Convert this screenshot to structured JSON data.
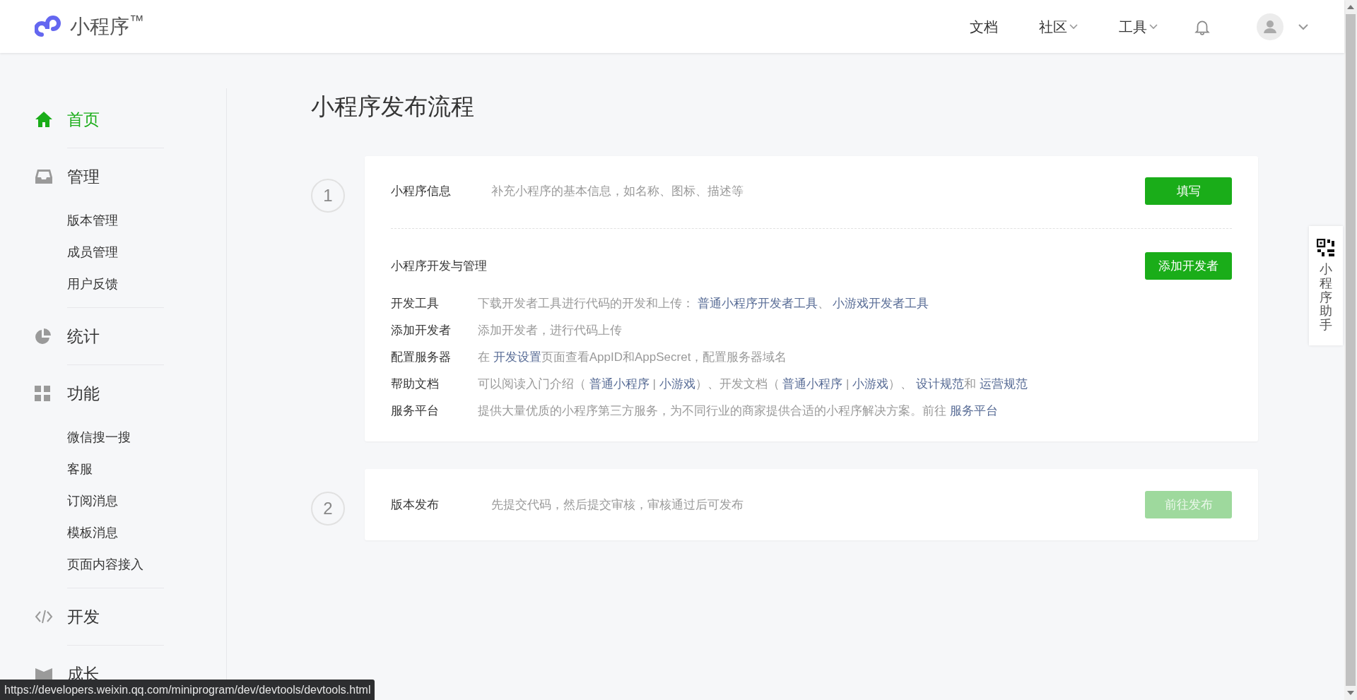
{
  "header": {
    "logo_text": "小程序$^{™}$",
    "nav": [
      {
        "label": "文档",
        "dropdown": false
      },
      {
        "label": "社区",
        "dropdown": true
      },
      {
        "label": "工具",
        "dropdown": true
      }
    ]
  },
  "sidebar": {
    "items": [
      {
        "label": "首页",
        "selected": true
      },
      {
        "label": "管理",
        "selected": false,
        "children": [
          {
            "label": "版本管理"
          },
          {
            "label": "成员管理"
          },
          {
            "label": "用户反馈"
          }
        ]
      },
      {
        "label": "统计",
        "selected": false
      },
      {
        "label": "功能",
        "selected": false,
        "children": [
          {
            "label": "微信搜一搜"
          },
          {
            "label": "客服"
          },
          {
            "label": "订阅消息"
          },
          {
            "label": "模板消息"
          },
          {
            "label": "页面内容接入"
          }
        ]
      },
      {
        "label": "开发",
        "selected": false
      },
      {
        "label": "成长",
        "selected": false
      }
    ]
  },
  "page_title": "小程序发布流程",
  "steps": [
    {
      "number": "1",
      "rows": [
        {
          "title": "小程序信息",
          "description": "补充小程序的基本信息，如名称、图标、描述等",
          "button": {
            "label": "填写",
            "disabled": false
          }
        }
      ],
      "section": {
        "title": "小程序开发与管理",
        "button": {
          "label": "添加开发者",
          "disabled": false
        },
        "items": [
          {
            "label": "开发工具",
            "segments": [
              {
                "text": "下载开发者工具进行代码的开发和上传： ",
                "link": false
              },
              {
                "text": "普通小程序开发者工具",
                "link": true
              },
              {
                "text": "、 ",
                "link": false
              },
              {
                "text": "小游戏开发者工具",
                "link": true
              }
            ]
          },
          {
            "label": "添加开发者",
            "segments": [
              {
                "text": "添加开发者，进行代码上传",
                "link": false
              }
            ]
          },
          {
            "label": "配置服务器",
            "segments": [
              {
                "text": "在 ",
                "link": false
              },
              {
                "text": "开发设置",
                "link": true
              },
              {
                "text": "页面查看AppID和AppSecret，配置服务器域名",
                "link": false
              }
            ]
          },
          {
            "label": "帮助文档",
            "segments": [
              {
                "text": "可以阅读入门介绍（ ",
                "link": false
              },
              {
                "text": "普通小程序",
                "link": true
              },
              {
                "text": " | ",
                "link": false
              },
              {
                "text": "小游戏",
                "link": true
              },
              {
                "text": "）、开发文档（ ",
                "link": false
              },
              {
                "text": "普通小程序",
                "link": true
              },
              {
                "text": " | ",
                "link": false
              },
              {
                "text": "小游戏",
                "link": true
              },
              {
                "text": "）、 ",
                "link": false
              },
              {
                "text": "设计规范",
                "link": true
              },
              {
                "text": "和 ",
                "link": false
              },
              {
                "text": "运营规范",
                "link": true
              }
            ]
          },
          {
            "label": "服务平台",
            "segments": [
              {
                "text": "提供大量优质的小程序第三方服务，为不同行业的商家提供合适的小程序解决方案。前往 ",
                "link": false
              },
              {
                "text": "服务平台",
                "link": true
              }
            ]
          }
        ]
      }
    },
    {
      "number": "2",
      "rows": [
        {
          "title": "版本发布",
          "description": "先提交代码，然后提交审核，审核通过后可发布",
          "button": {
            "label": "前往发布",
            "disabled": true
          }
        }
      ]
    }
  ],
  "assistant": {
    "label": "小程序助手"
  },
  "status_url": "https://developers.weixin.qq.com/miniprogram/dev/devtools/devtools.html"
}
